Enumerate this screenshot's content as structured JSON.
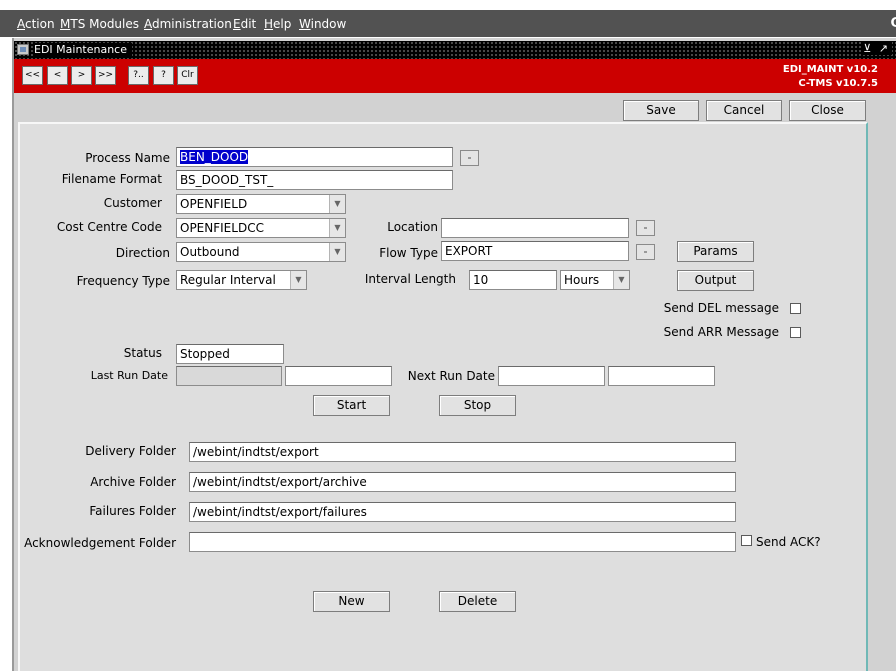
{
  "menubar": {
    "items": [
      {
        "accel": "A",
        "rest": "ction"
      },
      {
        "accel": "M",
        "rest": "TS Modules"
      },
      {
        "accel": "A",
        "rest": "dministration"
      },
      {
        "accel": "E",
        "rest": "dit"
      },
      {
        "accel": "H",
        "rest": "elp"
      },
      {
        "accel": "W",
        "rest": "indow"
      }
    ],
    "corner": "C"
  },
  "window": {
    "title": "EDI Maintenance",
    "controls": "⊻ ↗"
  },
  "toolbar": {
    "buttons": [
      "<<",
      "<",
      ">",
      ">>",
      "?..",
      "?",
      "Clr"
    ],
    "version_1": "EDI_MAINT v10.2",
    "version_2": "C-TMS v10.7.5"
  },
  "actions": {
    "save": "Save",
    "cancel": "Cancel",
    "close": "Close"
  },
  "form": {
    "process_name": {
      "label": "Process Name",
      "value": "BEN_DOOD"
    },
    "filename_format": {
      "label": "Filename Format",
      "value": "BS_DOOD_TST_"
    },
    "customer": {
      "label": "Customer",
      "value": "OPENFIELD"
    },
    "cost_centre_code": {
      "label": "Cost Centre Code",
      "value": "OPENFIELDCC"
    },
    "location": {
      "label": "Location",
      "value": ""
    },
    "direction": {
      "label": "Direction",
      "value": "Outbound"
    },
    "flow_type": {
      "label": "Flow Type",
      "value": "EXPORT"
    },
    "params_button": "Params",
    "frequency_type": {
      "label": "Frequency Type",
      "value": "Regular Interval"
    },
    "interval_length": {
      "label": "Interval Length",
      "value": "10",
      "unit": "Hours"
    },
    "output_button": "Output",
    "send_del": {
      "label": "Send DEL message",
      "checked": false
    },
    "send_arr": {
      "label": "Send ARR Message",
      "checked": false
    },
    "status": {
      "label": "Status",
      "value": "Stopped"
    },
    "last_run_date": {
      "label": "Last Run Date",
      "value_1": "",
      "value_2": ""
    },
    "next_run_date": {
      "label": "Next Run Date",
      "value_1": "",
      "value_2": ""
    },
    "start_button": "Start",
    "stop_button": "Stop",
    "delivery_folder": {
      "label": "Delivery Folder",
      "value": "/webint/indtst/export"
    },
    "archive_folder": {
      "label": "Archive Folder",
      "value": "/webint/indtst/export/archive"
    },
    "failures_folder": {
      "label": "Failures Folder",
      "value": "/webint/indtst/export/failures"
    },
    "acknowledgement_folder": {
      "label": "Acknowledgement Folder",
      "value": ""
    },
    "send_ack": {
      "label": "Send ACK?",
      "checked": false
    },
    "new_button": "New",
    "delete_button": "Delete"
  },
  "icons": {
    "window_icon": "form-icon",
    "dropdown": "triangle-down",
    "lov": "ellipsis-icon"
  }
}
